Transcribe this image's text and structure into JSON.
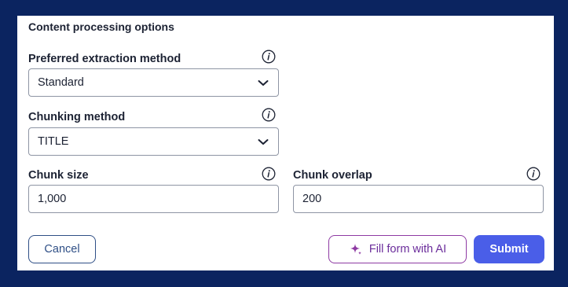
{
  "section_title": "Content processing options",
  "extraction": {
    "label": "Preferred extraction method",
    "value": "Standard"
  },
  "chunking": {
    "label": "Chunking method",
    "value": "TITLE"
  },
  "chunk_size": {
    "label": "Chunk size",
    "value": "1,000"
  },
  "chunk_overlap": {
    "label": "Chunk overlap",
    "value": "200"
  },
  "buttons": {
    "cancel": "Cancel",
    "ai": "Fill form with AI",
    "submit": "Submit"
  },
  "colors": {
    "backdrop": "#0b2460",
    "primary": "#4a5ee8",
    "ai_accent": "#8e3aa3",
    "cancel_border": "#2f4f86"
  },
  "icons": {
    "info": "info-circle-icon",
    "chevron": "chevron-down-icon",
    "sparkle": "sparkle-icon"
  }
}
